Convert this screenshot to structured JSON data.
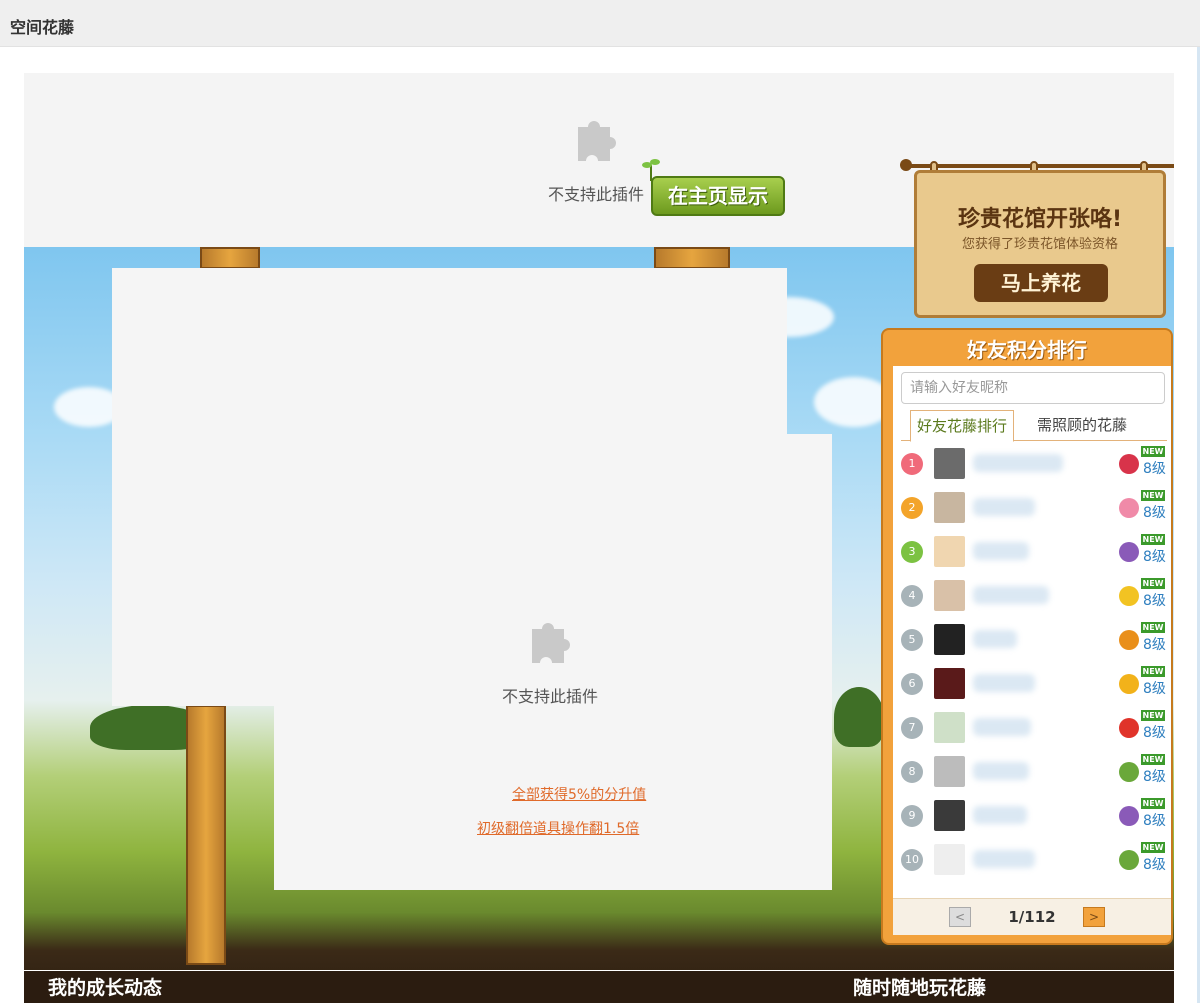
{
  "app": {
    "title": "空间花藤"
  },
  "plugin": {
    "unsupported_text": "不支持此插件"
  },
  "home_display_button": "在主页显示",
  "promo": {
    "title": "珍贵花馆开张咯!",
    "subtitle": "您获得了珍贵花馆体验资格",
    "button": "马上养花"
  },
  "ranking": {
    "title": "好友积分排行",
    "search_placeholder": "请输入好友昵称",
    "tabs": [
      "好友花藤排行",
      "需照顾的花藤"
    ],
    "rows": [
      {
        "rank": "1",
        "level": "8级",
        "badge": "NEW",
        "rank_color": "#f06a7a",
        "flower_color": "#d8334a"
      },
      {
        "rank": "2",
        "level": "8级",
        "badge": "NEW",
        "rank_color": "#f3a42a",
        "flower_color": "#f08aa8"
      },
      {
        "rank": "3",
        "level": "8级",
        "badge": "NEW",
        "rank_color": "#7cc242",
        "flower_color": "#8a5ab8"
      },
      {
        "rank": "4",
        "level": "8级",
        "badge": "NEW",
        "rank_color": "#a7b3b8",
        "flower_color": "#f2c322"
      },
      {
        "rank": "5",
        "level": "8级",
        "badge": "NEW",
        "rank_color": "#a7b3b8",
        "flower_color": "#e98f1a"
      },
      {
        "rank": "6",
        "level": "8级",
        "badge": "NEW",
        "rank_color": "#a7b3b8",
        "flower_color": "#f2b21a"
      },
      {
        "rank": "7",
        "level": "8级",
        "badge": "NEW",
        "rank_color": "#a7b3b8",
        "flower_color": "#e0332a"
      },
      {
        "rank": "8",
        "level": "8级",
        "badge": "NEW",
        "rank_color": "#a7b3b8",
        "flower_color": "#6aa83a"
      },
      {
        "rank": "9",
        "level": "8级",
        "badge": "NEW",
        "rank_color": "#a7b3b8",
        "flower_color": "#8a5ab8"
      },
      {
        "rank": "10",
        "level": "8级",
        "badge": "NEW",
        "rank_color": "#a7b3b8",
        "flower_color": "#6aa83a"
      }
    ],
    "pager": {
      "text": "1/112",
      "prev": "<",
      "next": ">"
    }
  },
  "game_links": [
    "全部获得5%的分升值",
    "初级翻倍道具操作翻1.5倍"
  ],
  "bottom": {
    "left": "我的成长动态",
    "right": "随时随地玩花藤"
  },
  "colors": {
    "accent_orange": "#f2a23c",
    "button_green": "#6d9a1e",
    "link_orange": "#e06a2a"
  }
}
